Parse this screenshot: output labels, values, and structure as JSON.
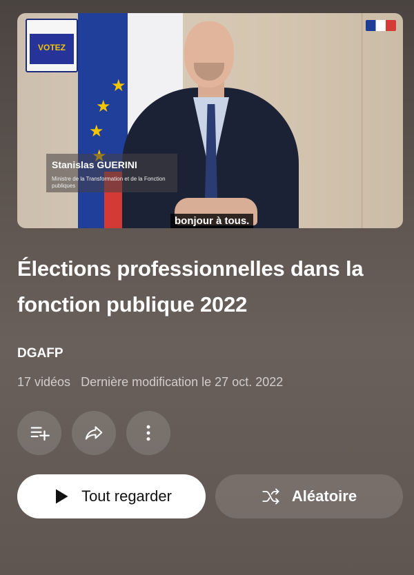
{
  "thumbnail": {
    "poster_text": "VOTEZ",
    "speaker_name": "Stanislas GUERINI",
    "speaker_role": "Ministre de la Transformation et de la Fonction publiques",
    "caption": "bonjour à tous."
  },
  "playlist": {
    "title": "Élections professionnelles dans la fonction publique 2022",
    "channel": "DGAFP",
    "video_count": "17 vidéos",
    "last_modified": "Dernière modification le 27 oct. 2022"
  },
  "actions": {
    "add_to_queue_icon": "playlist-add-icon",
    "share_icon": "share-icon",
    "more_icon": "more-vert-icon",
    "play_all_label": "Tout regarder",
    "shuffle_label": "Aléatoire"
  },
  "colors": {
    "primary_button_bg": "#ffffff",
    "secondary_button_bg": "rgba(255,255,255,0.13)"
  }
}
